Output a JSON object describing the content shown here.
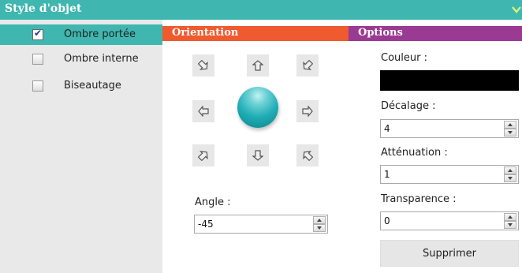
{
  "window": {
    "title": "Style d'objet",
    "accent": "#3fb7b0",
    "chevron_icon": "chevron-down-icon"
  },
  "sidebar": {
    "items": [
      {
        "label": "Ombre portée",
        "checked": true
      },
      {
        "label": "Ombre interne",
        "checked": false
      },
      {
        "label": "Biseautage",
        "checked": false
      }
    ]
  },
  "orientation": {
    "header": "Orientation",
    "header_color": "#ef5a2f",
    "buttons": [
      "arrow-up-left-icon",
      "arrow-up-icon",
      "arrow-up-right-icon",
      "arrow-left-icon",
      "arrow-right-icon",
      "arrow-down-left-icon",
      "arrow-down-icon",
      "arrow-down-right-icon"
    ],
    "angle_label": "Angle :",
    "angle_value": "-45"
  },
  "options": {
    "header": "Options",
    "header_color": "#9b3a93",
    "color_label": "Couleur :",
    "color_value": "#000000",
    "offset_label": "Décalage :",
    "offset_value": "4",
    "blur_label": "Atténuation :",
    "blur_value": "1",
    "transparency_label": "Transparence :",
    "transparency_value": "0",
    "delete_label": "Supprimer"
  }
}
